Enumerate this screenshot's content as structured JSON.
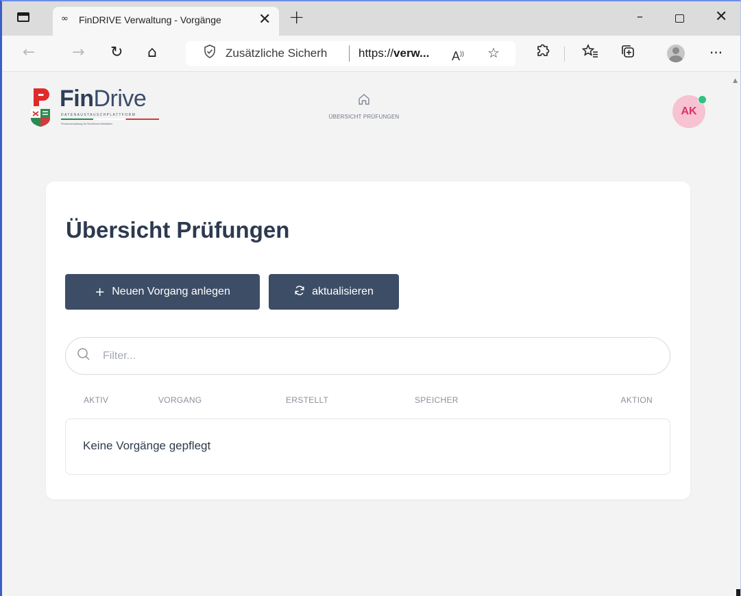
{
  "browser": {
    "tab": {
      "favicon": "∞",
      "title": "FinDRIVE Verwaltung - Vorgänge",
      "close": "✕"
    },
    "new_tab": "+",
    "window_controls": {
      "minimize": "–",
      "close": "✕"
    },
    "nav": {
      "back": "←",
      "forward": "→",
      "reload": "↻",
      "home": "⌂"
    },
    "address": {
      "shield_icon": "shield-check-icon",
      "security_text": "Zusätzliche Sicherh",
      "url_prefix": "https://",
      "url_host": "verw...",
      "read_aloud": "A⁾",
      "favorite_icon": "☆"
    },
    "toolbar_icons": {
      "extensions": "⚙",
      "favorites": "☆",
      "collections": "⧉",
      "more": "···"
    }
  },
  "app": {
    "logo": {
      "fin": "Fin",
      "drive": "Drive",
      "tagline": "DATENAUSTAUSCHPLATTFORM",
      "subline": "Finanzverwaltung für Nordrhein-Westfalen"
    },
    "nav": {
      "home_label": "ÜBERSICHT PRÜFUNGEN",
      "home_icon": "⌂"
    },
    "user": {
      "initials": "AK",
      "status": "online"
    }
  },
  "main": {
    "title": "Übersicht Prüfungen",
    "buttons": {
      "new_label": "Neuen Vorgang anlegen",
      "new_icon": "+",
      "refresh_label": "aktualisieren",
      "refresh_icon": "⟳"
    },
    "filter": {
      "placeholder": "Filter...",
      "value": "",
      "icon": "search-icon"
    },
    "table": {
      "columns": [
        "AKTIV",
        "VORGANG",
        "ERSTELLT",
        "SPEICHER",
        "AKTION"
      ],
      "empty_message": "Keine Vorgänge gepflegt"
    }
  },
  "colors": {
    "primary_button": "#3d4d66",
    "title_text": "#2d3a4f",
    "avatar_bg": "#f7c2d2",
    "avatar_text": "#d6336c",
    "status_online": "#2ec27e",
    "page_bg": "#f3f3f3"
  }
}
